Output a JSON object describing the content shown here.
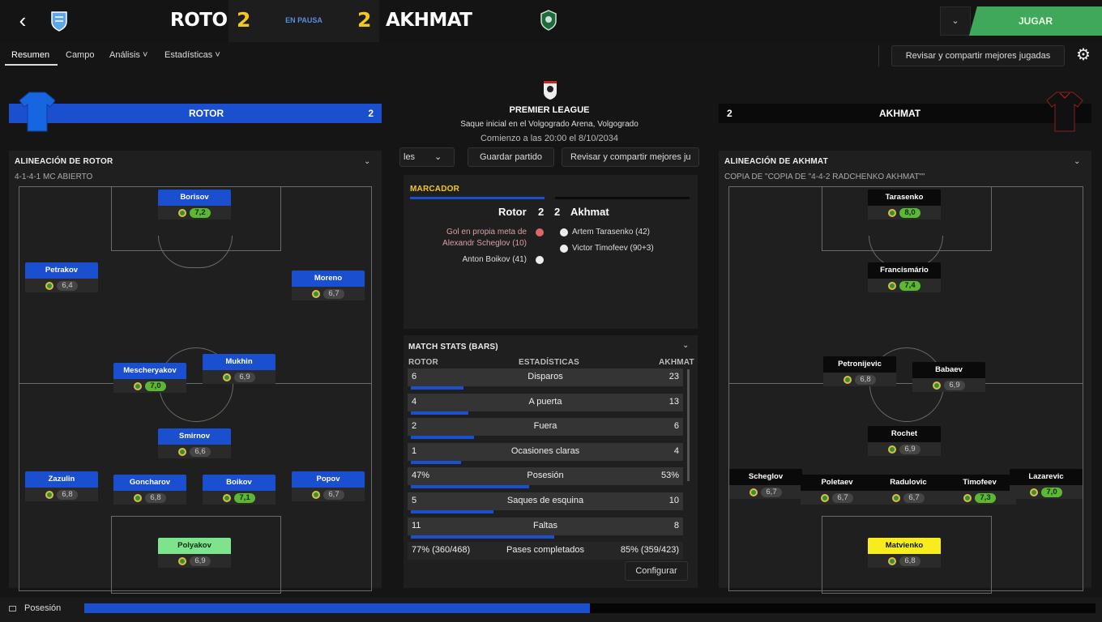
{
  "header": {
    "home_team": "ROTOR",
    "away_team": "AKHMAT",
    "home_score": "2",
    "away_score": "2",
    "status": "EN PAUSA",
    "play_label": "JUGAR",
    "dropdown_icon": "chevron-down-icon"
  },
  "tabs": [
    {
      "label": "Resumen"
    },
    {
      "label": "Campo"
    },
    {
      "label": "Análisis ˅"
    },
    {
      "label": "Estadísticas ˅"
    }
  ],
  "review_label": "Revisar y compartir mejores jugadas",
  "home": {
    "bar_name": "ROTOR",
    "bar_score": "2",
    "lineup_title": "ALINEACIÓN DE ROTOR",
    "formation": "4-1-4-1 MC ABIERTO",
    "players": [
      {
        "name": "Borisov",
        "rating": "7,2",
        "good": true
      },
      {
        "name": "Petrakov",
        "rating": "6,4",
        "good": false
      },
      {
        "name": "Moreno",
        "rating": "6,7",
        "good": false
      },
      {
        "name": "Mescheryakov",
        "rating": "7,0",
        "good": true
      },
      {
        "name": "Mukhin",
        "rating": "6,9",
        "good": false
      },
      {
        "name": "Smirnov",
        "rating": "6,6",
        "good": false
      },
      {
        "name": "Zazulin",
        "rating": "6,8",
        "good": false
      },
      {
        "name": "Goncharov",
        "rating": "6,8",
        "good": false
      },
      {
        "name": "Boikov",
        "rating": "7,1",
        "good": true
      },
      {
        "name": "Popov",
        "rating": "6,7",
        "good": false
      },
      {
        "name": "Polyakov",
        "rating": "6,9",
        "good": false
      }
    ]
  },
  "away": {
    "bar_name": "AKHMAT",
    "bar_score": "2",
    "lineup_title": "ALINEACIÓN DE AKHMAT",
    "formation": "COPIA DE \"COPIA DE \"4-4-2 RADCHENKO AKHMAT\"\"",
    "players": [
      {
        "name": "Tarasenko",
        "rating": "8,0",
        "good": true
      },
      {
        "name": "Francismário",
        "rating": "7,4",
        "good": true
      },
      {
        "name": "Petronijevic",
        "rating": "6,8",
        "good": false
      },
      {
        "name": "Babaev",
        "rating": "6,9",
        "good": false
      },
      {
        "name": "Rochet",
        "rating": "6,9",
        "good": false
      },
      {
        "name": "Scheglov",
        "rating": "6,7",
        "good": false
      },
      {
        "name": "Poletaev",
        "rating": "6,7",
        "good": false
      },
      {
        "name": "Radulovic",
        "rating": "6,7",
        "good": false
      },
      {
        "name": "Timofeev",
        "rating": "7,3",
        "good": true
      },
      {
        "name": "Lazarevic",
        "rating": "7,0",
        "good": true
      },
      {
        "name": "Matvienko",
        "rating": "6,8",
        "good": false
      }
    ]
  },
  "match": {
    "competition": "PREMIER LEAGUE",
    "venue": "Saque inicial en el Volgogrado Arena, Volgogrado",
    "kickoff": "Comienzo a las 20:00 el 8/10/2034"
  },
  "toolbar": {
    "partial_left": "les",
    "save": "Guardar partido",
    "review": "Revisar y compartir mejores ju"
  },
  "scoreboard": {
    "title": "MARCADOR",
    "home": "Rotor",
    "home_score": "2",
    "away_score": "2",
    "away": "Akhmat",
    "home_events": [
      "Gol en propia meta de",
      "Alexandr Scheglov (10)",
      "Anton Boikov (41)"
    ],
    "away_events": [
      "Artem Tarasenko (42)",
      "Victor Timofeev (90+3)"
    ]
  },
  "stats": {
    "title": "MATCH STATS (BARS)",
    "col_left": "ROTOR",
    "col_mid": "ESTADÍSTICAS",
    "col_right": "AKHMAT",
    "rows": [
      {
        "left": "6",
        "label": "Disparos",
        "right": "23",
        "share": 0.21
      },
      {
        "left": "4",
        "label": "A puerta",
        "right": "13",
        "share": 0.23
      },
      {
        "left": "2",
        "label": "Fuera",
        "right": "6",
        "share": 0.25
      },
      {
        "left": "1",
        "label": "Ocasiones claras",
        "right": "4",
        "share": 0.2
      },
      {
        "left": "47%",
        "label": "Posesión",
        "right": "53%",
        "share": 0.47
      },
      {
        "left": "5",
        "label": "Saques de esquina",
        "right": "10",
        "share": 0.33
      },
      {
        "left": "11",
        "label": "Faltas",
        "right": "8",
        "share": 0.57
      },
      {
        "left": "77% (360/468)",
        "label": "Pases completados",
        "right": "85% (359/423)"
      }
    ],
    "configure": "Configurar"
  },
  "footer": {
    "label": "Posesión",
    "home_share": 0.5
  },
  "colors": {
    "home": "#1a4fd0",
    "away": "#0a0a0a",
    "accent": "#3fa85a",
    "score": "#f3c81e"
  }
}
